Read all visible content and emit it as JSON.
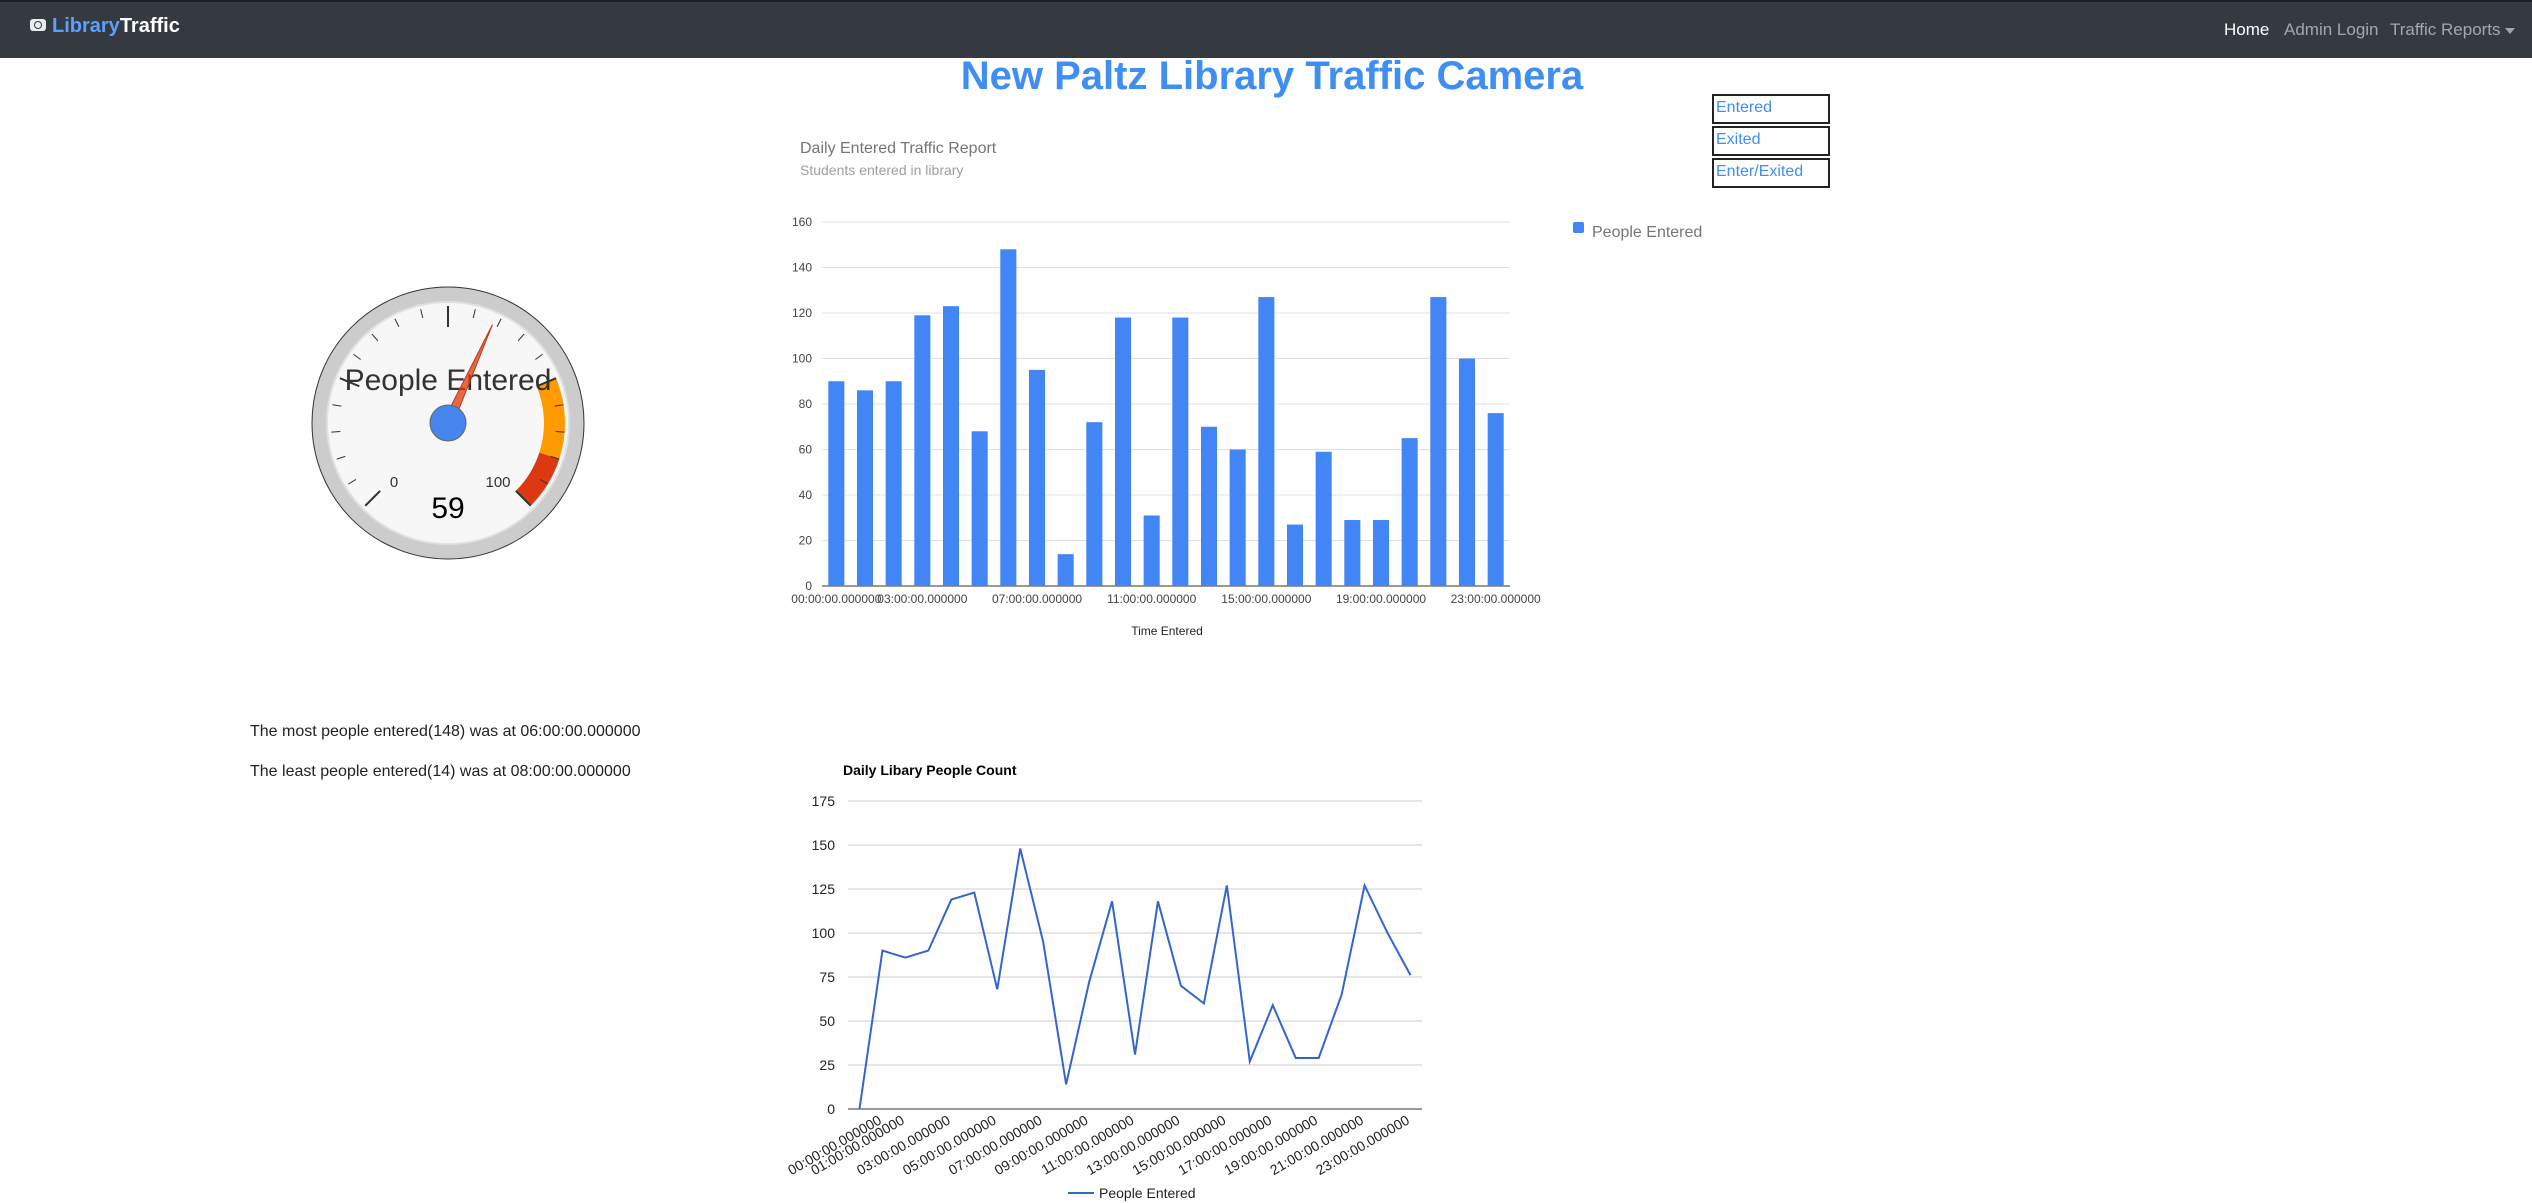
{
  "navbar": {
    "brand_part1": "Library",
    "brand_part2": "Traffic",
    "brand_icon": "camera-icon",
    "links": {
      "home": "Home",
      "admin": "Admin Login",
      "reports": "Traffic Reports"
    }
  },
  "page_title": "New Paltz Library Traffic Camera",
  "report_links": [
    "Entered",
    "Exited",
    "Enter/Exited"
  ],
  "gauge": {
    "label": "People Entered",
    "value": 59,
    "min": 0,
    "max": 100,
    "min_label": "0",
    "max_label": "100"
  },
  "stats": {
    "most": "The most people entered(148) was at 06:00:00.000000",
    "least": "The least people entered(14) was at 08:00:00.000000"
  },
  "chart_data": [
    {
      "type": "bar",
      "title": "Daily Entered Traffic Report",
      "subtitle": "Students entered in library",
      "xlabel": "Time Entered",
      "ylabel": "",
      "ylim": [
        0,
        160
      ],
      "yticks": [
        0,
        20,
        40,
        60,
        80,
        100,
        120,
        140,
        160
      ],
      "xticklabels": [
        "00:00:00.000000",
        "03:00:00.000000",
        "07:00:00.000000",
        "11:00:00.000000",
        "15:00:00.000000",
        "19:00:00.000000",
        "23:00:00.000000"
      ],
      "legend": "right",
      "series": [
        {
          "name": "People Entered",
          "color": "#4285f4",
          "values": [
            90,
            86,
            90,
            119,
            123,
            68,
            148,
            95,
            14,
            72,
            118,
            31,
            118,
            70,
            60,
            127,
            27,
            59,
            29,
            29,
            65,
            127,
            100,
            76
          ]
        }
      ]
    },
    {
      "type": "line",
      "title": "Daily Libary People Count",
      "ylim": [
        0,
        175
      ],
      "yticks": [
        0,
        25,
        50,
        75,
        100,
        125,
        150,
        175
      ],
      "xticklabels": [
        "00:00:00.000000",
        "01:00:00.000000",
        "03:00:00.000000",
        "05:00:00.000000",
        "07:00:00.000000",
        "09:00:00.000000",
        "11:00:00.000000",
        "13:00:00.000000",
        "15:00:00.000000",
        "17:00:00.000000",
        "19:00:00.000000",
        "21:00:00.000000",
        "23:00:00.000000"
      ],
      "legend": "bottom",
      "series": [
        {
          "name": "People Entered",
          "color": "#3366cc",
          "values": [
            0,
            90,
            86,
            90,
            119,
            123,
            68,
            148,
            95,
            14,
            72,
            118,
            31,
            118,
            70,
            60,
            127,
            27,
            59,
            29,
            29,
            65,
            127,
            100,
            76
          ]
        }
      ]
    }
  ]
}
